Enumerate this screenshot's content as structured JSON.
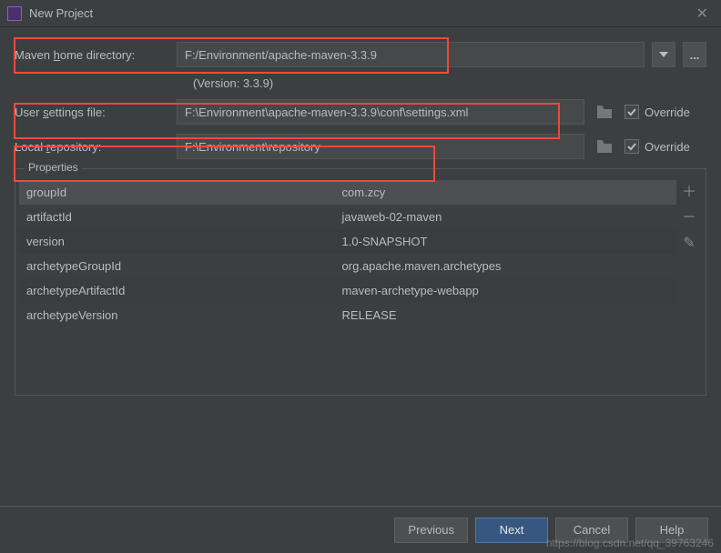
{
  "window": {
    "title": "New Project"
  },
  "fields": {
    "maven_home_label_pre": "Maven ",
    "maven_home_label_u": "h",
    "maven_home_label_post": "ome directory:",
    "maven_home_value": "F:/Environment/apache-maven-3.3.9",
    "version_label": "(Version: 3.3.9)",
    "user_settings_label_pre": "User ",
    "user_settings_label_u": "s",
    "user_settings_label_post": "ettings file:",
    "user_settings_value": "F:\\Environment\\apache-maven-3.3.9\\conf\\settings.xml",
    "local_repo_label_pre": "Local ",
    "local_repo_label_u": "r",
    "local_repo_label_post": "epository:",
    "local_repo_value": "F:\\Environment\\repository",
    "override_label": "Override",
    "dots_label": "..."
  },
  "properties": {
    "legend": "Properties",
    "rows": [
      {
        "key": "groupId",
        "value": "com.zcy"
      },
      {
        "key": "artifactId",
        "value": "javaweb-02-maven"
      },
      {
        "key": "version",
        "value": "1.0-SNAPSHOT"
      },
      {
        "key": "archetypeGroupId",
        "value": "org.apache.maven.archetypes"
      },
      {
        "key": "archetypeArtifactId",
        "value": "maven-archetype-webapp"
      },
      {
        "key": "archetypeVersion",
        "value": "RELEASE"
      }
    ]
  },
  "buttons": {
    "previous_u": "P",
    "previous_rest": "revious",
    "next_u": "N",
    "next_rest": "ext",
    "cancel": "Cancel",
    "help": "Help"
  },
  "watermark": "https://blog.csdn.net/qq_39763246"
}
